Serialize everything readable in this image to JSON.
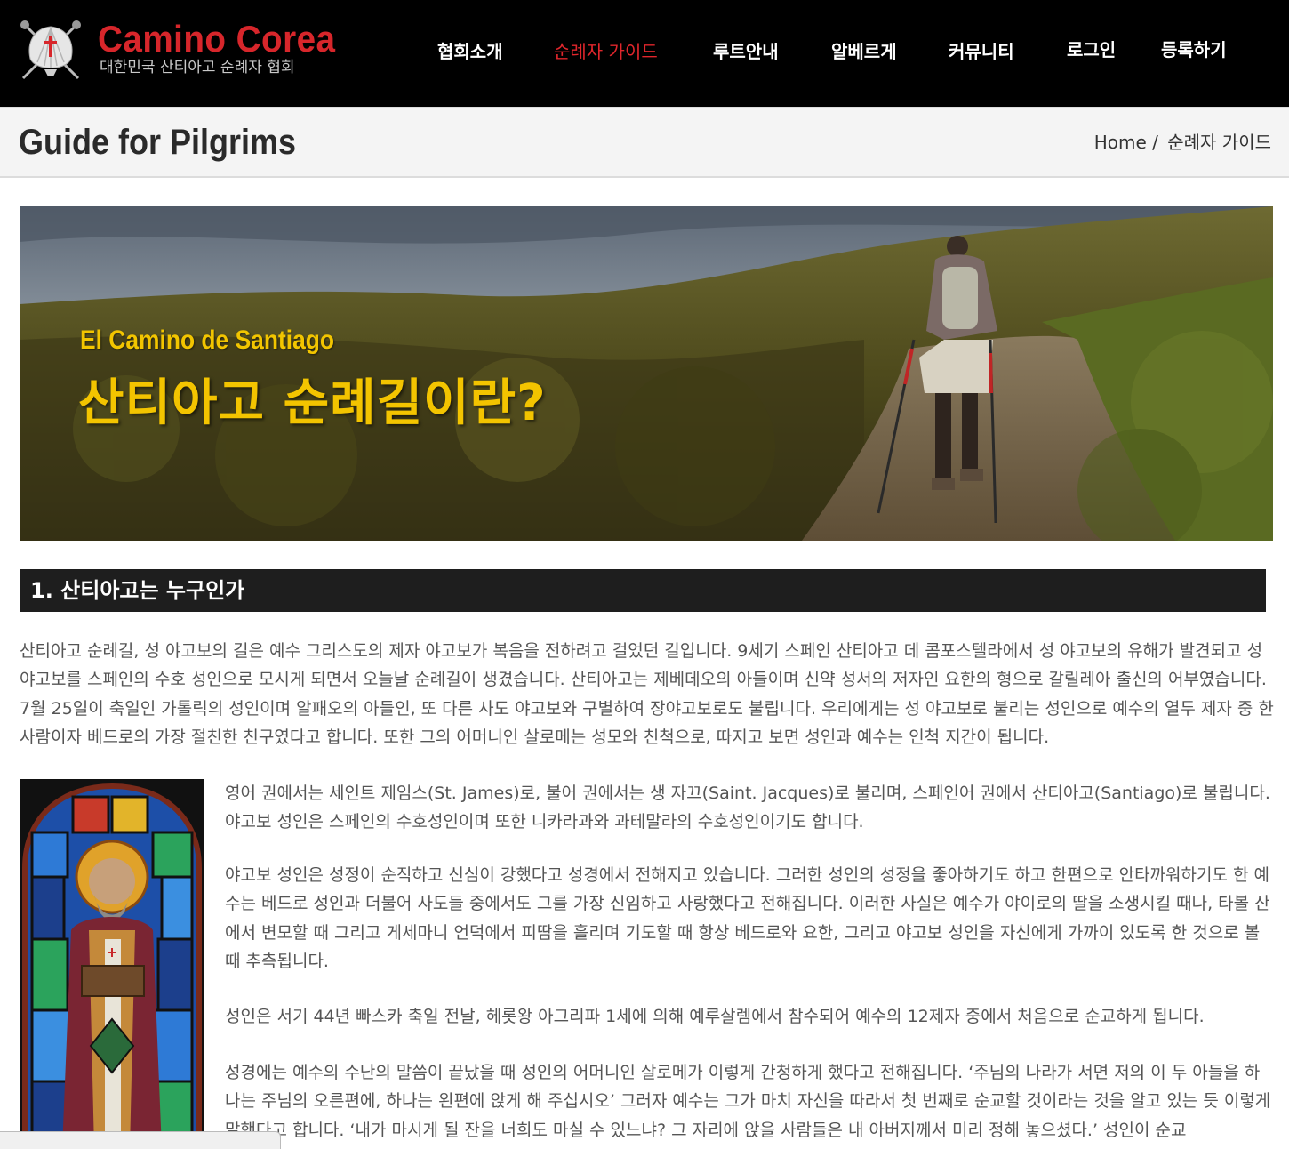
{
  "header": {
    "brand_title": "Camino Corea",
    "brand_subtitle": "대한민국 산티아고 순례자 협회",
    "nav": [
      {
        "label": "협회소개",
        "active": false
      },
      {
        "label": "순례자 가이드",
        "active": true
      },
      {
        "label": "루트안내",
        "active": false
      },
      {
        "label": "알베르게",
        "active": false
      },
      {
        "label": "커뮤니티",
        "active": false
      },
      {
        "label": "로그인",
        "active": false
      },
      {
        "label": "등록하기",
        "active": false
      }
    ]
  },
  "page": {
    "title": "Guide for Pilgrims",
    "breadcrumb_home": "Home /",
    "breadcrumb_current": "순례자 가이드"
  },
  "hero": {
    "eng_title": "El Camino de Santiago",
    "kor_title": "산티아고 순례길이란?"
  },
  "section1": {
    "heading": "1. 산티아고는 누구인가",
    "paragraphs": [
      "산티아고 순례길, 성 야고보의 길은 예수 그리스도의 제자 야고보가 복음을 전하려고 걸었던 길입니다. 9세기 스페인 산티아고 데 콤포스텔라에서 성 야고보의 유해가 발견되고 성 야고보를 스페인의 수호 성인으로 모시게 되면서 오늘날 순례길이 생겼습니다. 산티아고는 제베데오의 아들이며 신약 성서의 저자인 요한의 형으로 갈릴레아 출신의 어부였습니다. 7월 25일이 축일인 가톨릭의 성인이며 알패오의 아들인, 또 다른 사도 야고보와 구별하여 장야고보로도 불립니다. 우리에게는 성 야고보로 불리는 성인으로 예수의 열두 제자 중 한 사람이자 베드로의 가장 절친한 친구였다고 합니다. 또한 그의 어머니인 살로메는 성모와 친척으로, 따지고 보면 성인과 예수는 인척 지간이 됩니다.",
      "영어 권에서는 세인트 제임스(St. James)로, 불어 권에서는 생 자끄(Saint. Jacques)로 불리며, 스페인어 권에서 산티아고(Santiago)로 불립니다. 야고보 성인은 스페인의 수호성인이며 또한 니카라과와 과테말라의 수호성인이기도 합니다.",
      "야고보 성인은 성정이 순직하고 신심이 강했다고 성경에서 전해지고 있습니다. 그러한 성인의 성정을 좋아하기도 하고 한편으로 안타까워하기도 한 예수는 베드로 성인과 더불어 사도들 중에서도 그를 가장 신임하고 사랑했다고 전해집니다. 이러한 사실은 예수가 야이로의 딸을 소생시킬 때나, 타볼 산에서 변모할 때 그리고 게세마니 언덕에서 피땀을 흘리며 기도할 때 항상 베드로와 요한, 그리고 야고보 성인을 자신에게 가까이 있도록 한 것으로 볼 때 추측됩니다.",
      "성인은 서기 44년 빠스카 축일 전날, 헤롯왕 아그리파 1세에 의해 예루살렘에서 참수되어 예수의 12제자 중에서 처음으로 순교하게 됩니다.",
      "성경에는 예수의 수난의 말씀이 끝났을 때 성인의 어머니인 살로메가 이렇게 간청하게 했다고 전해집니다. ‘주님의 나라가 서면 저의 이 두 아들을 하나는 주님의 오른편에, 하나는 왼편에 앉게 해 주십시오’ 그러자 예수는 그가 마치 자신을 따라서 첫 번째로 순교할 것이라는 것을 알고 있는 듯 이렇게 말했다고 합니다. ‘내가 마시게 될 잔을 너희도 마실 수 있느냐? 그 자리에 앉을 사람들은 내 아버지께서 미리 정해 놓으셨다.’ 성인이 순교"
    ]
  },
  "colors": {
    "header_bg": "#000000",
    "brand_red": "#d7262b",
    "active_nav": "#e0262c",
    "hero_text": "#f3c400",
    "section_bg": "#1e1e1e"
  }
}
